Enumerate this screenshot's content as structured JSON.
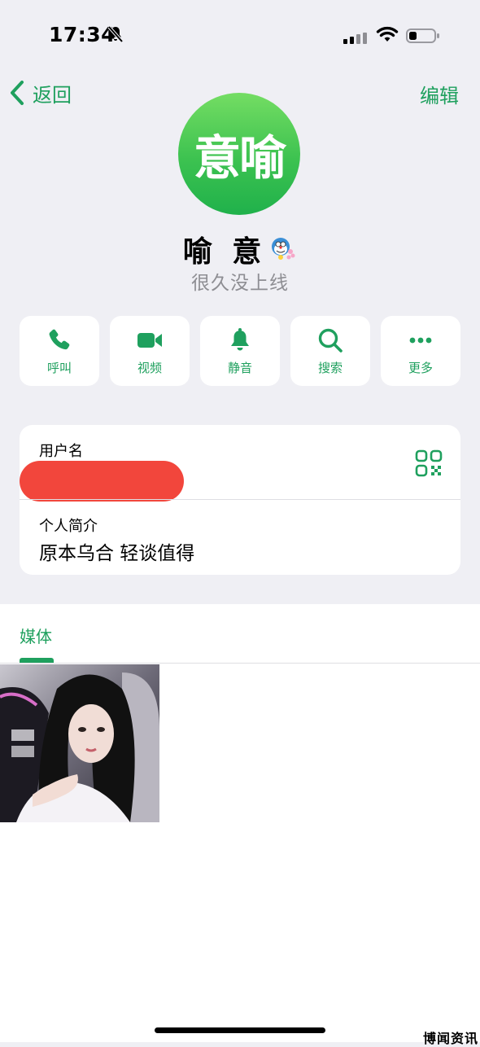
{
  "status_bar": {
    "time": "17:34"
  },
  "nav": {
    "back_label": "返回",
    "edit_label": "编辑"
  },
  "profile": {
    "avatar_text": "意喻",
    "name": "喻 意",
    "status": "很久没上线"
  },
  "actions": [
    {
      "label": "呼叫",
      "icon": "phone-icon"
    },
    {
      "label": "视频",
      "icon": "video-icon"
    },
    {
      "label": "静音",
      "icon": "bell-icon"
    },
    {
      "label": "搜索",
      "icon": "search-icon"
    },
    {
      "label": "更多",
      "icon": "more-icon"
    }
  ],
  "info": {
    "username_label": "用户名",
    "bio_label": "个人简介",
    "bio_value": "原本乌合 轻谈值得"
  },
  "media": {
    "tab_label": "媒体"
  },
  "watermark": "博闻资讯",
  "colors": {
    "accent": "#1fa05e",
    "background": "#efeff4",
    "redaction": "#f2463c"
  }
}
